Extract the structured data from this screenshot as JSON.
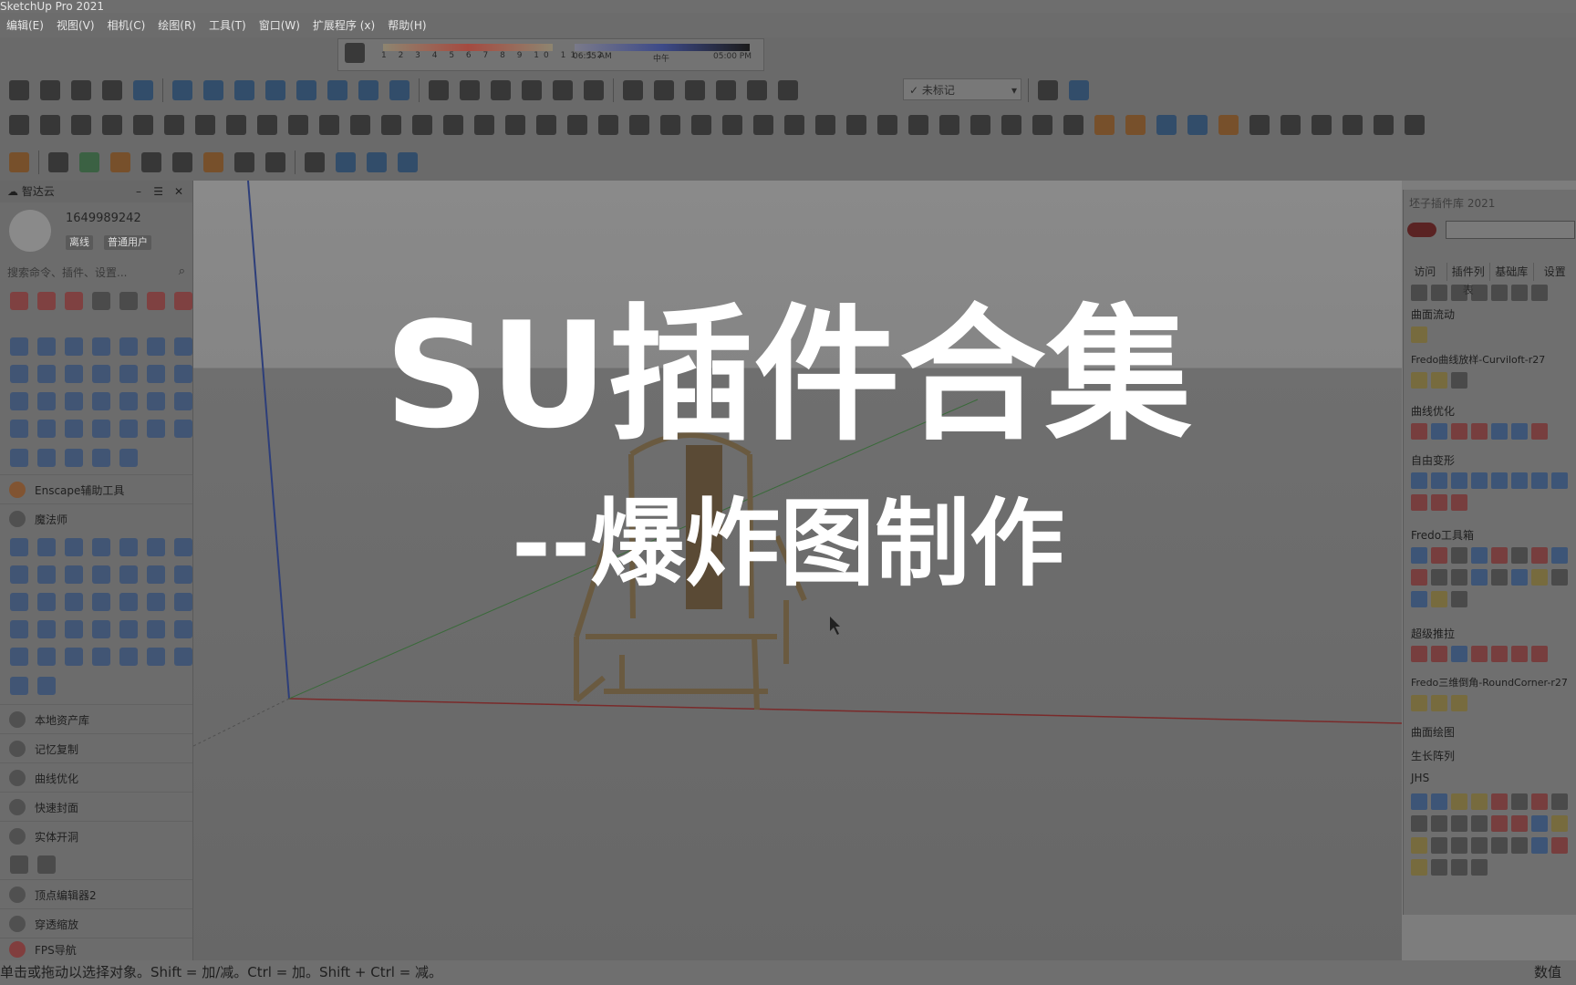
{
  "app": {
    "title": "SketchUp Pro 2021"
  },
  "menu": [
    "编辑(E)",
    "视图(V)",
    "相机(C)",
    "绘图(R)",
    "工具(T)",
    "窗口(W)",
    "扩展程序 (x)",
    "帮助(H)"
  ],
  "shadow": {
    "months": "1 2 3 4 5 6 7 8 9 10 11 12",
    "time_start": "06:55 AM",
    "time_mid": "中午",
    "time_end": "05:00 PM"
  },
  "tag_dropdown": "未标记",
  "sidebar": {
    "title": "智达云",
    "user_id": "1649989242",
    "badge_status": "离线",
    "badge_level": "普通用户",
    "search_placeholder": "搜索命令、插件、设置...",
    "sections": [
      {
        "label": "Enscape辅助工具"
      },
      {
        "label": "魔法师"
      },
      {
        "label": "本地资产库"
      },
      {
        "label": "记忆复制"
      },
      {
        "label": "曲线优化"
      },
      {
        "label": "快速封面"
      },
      {
        "label": "实体开洞"
      },
      {
        "label": "顶点编辑器2"
      },
      {
        "label": "穿透缩放"
      },
      {
        "label": "FPS导航"
      }
    ]
  },
  "right_panel": {
    "title": "坯子插件库 2021",
    "tabs": [
      "访问",
      "插件列表",
      "基础库",
      "设置"
    ],
    "sections": [
      {
        "label": "曲面流动"
      },
      {
        "label": "Fredo曲线放样-Curviloft-r27"
      },
      {
        "label": "曲线优化"
      },
      {
        "label": "自由变形"
      },
      {
        "label": "Fredo工具箱"
      },
      {
        "label": "超级推拉"
      },
      {
        "label": "Fredo三维倒角-RoundCorner-r27"
      },
      {
        "label": "曲面绘图"
      },
      {
        "label": "生长阵列"
      },
      {
        "label": "JHS"
      }
    ]
  },
  "overlay": {
    "title": "SU插件合集",
    "subtitle": "--爆炸图制作"
  },
  "status": {
    "hint": "单击或拖动以选择对象。Shift = 加/减。Ctrl = 加。Shift + Ctrl = 减。",
    "value_label": "数值"
  }
}
